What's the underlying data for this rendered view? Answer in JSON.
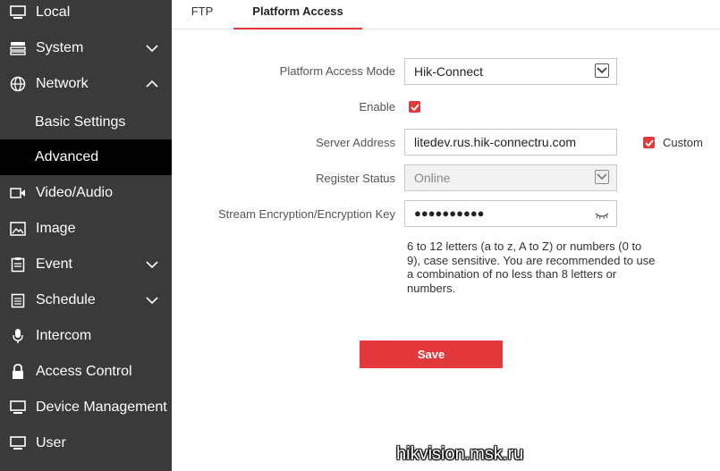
{
  "sidebar": {
    "items": [
      {
        "label": "Local",
        "icon": "monitor-icon"
      },
      {
        "label": "System",
        "icon": "system-icon",
        "expanded": false
      },
      {
        "label": "Network",
        "icon": "globe-icon",
        "expanded": true
      },
      {
        "label": "Basic Settings"
      },
      {
        "label": "Advanced",
        "selected": true
      },
      {
        "label": "Video/Audio",
        "icon": "video-icon"
      },
      {
        "label": "Image",
        "icon": "image-icon"
      },
      {
        "label": "Event",
        "icon": "event-icon",
        "expanded": false
      },
      {
        "label": "Schedule",
        "icon": "schedule-icon",
        "expanded": false
      },
      {
        "label": "Intercom",
        "icon": "microphone-icon"
      },
      {
        "label": "Access Control",
        "icon": "lock-icon"
      },
      {
        "label": "Device Management",
        "icon": "device-icon"
      },
      {
        "label": "User",
        "icon": "user-monitor-icon"
      }
    ]
  },
  "tabs": [
    {
      "label": "FTP",
      "active": false
    },
    {
      "label": "Platform Access",
      "active": true
    }
  ],
  "form": {
    "mode_label": "Platform Access Mode",
    "mode_value": "Hik-Connect",
    "enable_label": "Enable",
    "enable_checked": true,
    "server_label": "Server Address",
    "server_value": "litedev.rus.hik-connectru.com",
    "custom_label": "Custom",
    "custom_checked": true,
    "status_label": "Register Status",
    "status_value": "Online",
    "key_label": "Stream Encryption/Encryption Key",
    "key_value": "●●●●●●●●●●",
    "hint": "6 to 12 letters (a to z, A to Z) or numbers (0 to 9), case sensitive. You are recommended to use a combination of no less than 8 letters or numbers.",
    "save_label": "Save"
  },
  "watermark": "hikvision.msk.ru",
  "colors": {
    "accent": "#e4393c",
    "sidebar_bg": "#3a3a3a",
    "sidebar_active": "#000000"
  }
}
